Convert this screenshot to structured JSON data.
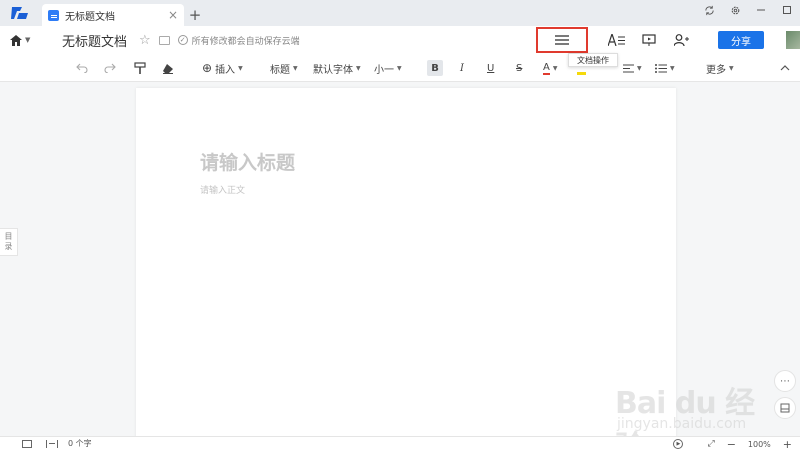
{
  "titlebar": {
    "tab_title": "无标题文档",
    "close_glyph": "×",
    "new_tab_glyph": "+"
  },
  "header": {
    "doc_title": "无标题文档",
    "save_status": "所有修改都会自动保存云端",
    "share_label": "分享",
    "doc_ops_tooltip": "文档操作"
  },
  "toolbar": {
    "insert_label": "插入",
    "heading_label": "标题",
    "font_label": "默认字体",
    "size_label": "小一",
    "bold_label": "B",
    "italic_label": "I",
    "underline_label": "U",
    "strike_label": "S",
    "color_label": "A",
    "more_label": "更多"
  },
  "document": {
    "title_placeholder": "请输入标题",
    "body_placeholder": "请输入正文"
  },
  "sidebar": {
    "toc_label_1": "目",
    "toc_label_2": "录"
  },
  "statusbar": {
    "word_count": "0 个字",
    "zoom": "100%",
    "zoom_out": "−",
    "zoom_in": "+"
  },
  "watermark": {
    "main": "Bai du 经验",
    "sub": "jingyan.baidu.com"
  },
  "colors": {
    "accent": "#1a73e8",
    "highlight_box": "#e03a2e",
    "font_color_bar": "#e03a2e",
    "highlight_marker": "#f5d90a"
  }
}
